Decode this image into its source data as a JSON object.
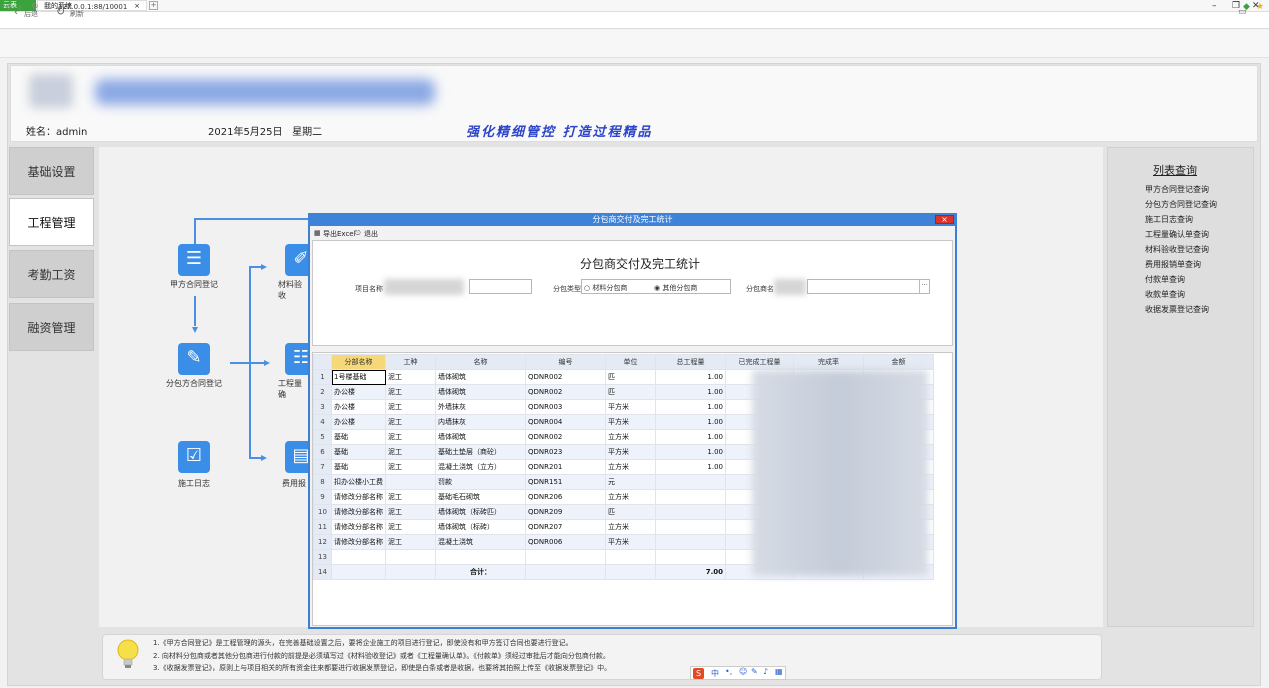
{
  "browser": {
    "tab1_label": "云表",
    "tab2_label": "我的系统",
    "tab_close": "×",
    "new_tab": "+",
    "url": "127.0.0.1:88/10001",
    "back_label": "后退",
    "refresh_label": "刷新"
  },
  "header": {
    "user": "姓名：admin",
    "date": "2021年5月25日",
    "weekday": "星期二",
    "slogan": "强化精细管控  打造过程精品"
  },
  "sidebar": {
    "items": [
      {
        "label": "基础设置"
      },
      {
        "label": "工程管理"
      },
      {
        "label": "考勤工资"
      },
      {
        "label": "融资管理"
      }
    ]
  },
  "flow": {
    "items": [
      {
        "label": "甲方合同登记"
      },
      {
        "label": "分包方合同登记"
      },
      {
        "label": "施工日志"
      },
      {
        "label": "材料验收"
      },
      {
        "label": "工程量确"
      },
      {
        "label": "费用报"
      }
    ]
  },
  "right_panel": {
    "title": "列表查询",
    "links": [
      "甲方合同登记查询",
      "分包方合同登记查询",
      "施工日志查询",
      "工程量确认单查询",
      "材料验收登记查询",
      "费用报销单查询",
      "付款单查询",
      "收款单查询",
      "收据发票登记查询"
    ]
  },
  "tips": [
    "1.《甲方合同登记》是工程管理的源头，在完善基础设置之后，要将企业施工的项目进行登记，即使没有和甲方签订合同也要进行登记。",
    "2. 向材料分包商或者其他分包商进行付款的前提是必须填写过《材料验收登记》或者《工程量确认单》。《付款单》须经过审批后才能向分包商付款。",
    "3.《收据发票登记》，原则上与项目相关的所有资金往来都要进行收据发票登记，即使是白条或者是收据，也要将其拍照上传至《收据发票登记》中。"
  ],
  "modal": {
    "title": "分包商交付及完工统计",
    "close": "×",
    "export_label": "导出Excel",
    "exit_label": "退出",
    "form_title": "分包商交付及完工统计",
    "project_label": "项目名称",
    "type_label": "分包类型",
    "radio_material": "材料分包商",
    "radio_other": "其他分包商",
    "sub_label": "分包商名",
    "ellipsis": "···"
  },
  "table": {
    "headers": [
      "分部名称",
      "工种",
      "名称",
      "编号",
      "单位",
      "总工程量",
      "已完成工程量",
      "完成率",
      "金额"
    ],
    "rows": [
      {
        "n": "1",
        "part": "1号楼基础",
        "work": "泥工",
        "name": "墙体砌筑",
        "code": "QDNR002",
        "unit": "匹",
        "qty": "1.00"
      },
      {
        "n": "2",
        "part": "办公楼",
        "work": "泥工",
        "name": "墙体砌筑",
        "code": "QDNR002",
        "unit": "匹",
        "qty": "1.00"
      },
      {
        "n": "3",
        "part": "办公楼",
        "work": "泥工",
        "name": "外墙抹灰",
        "code": "QDNR003",
        "unit": "平方米",
        "qty": "1.00"
      },
      {
        "n": "4",
        "part": "办公楼",
        "work": "泥工",
        "name": "内墙抹灰",
        "code": "QDNR004",
        "unit": "平方米",
        "qty": "1.00"
      },
      {
        "n": "5",
        "part": "基础",
        "work": "泥工",
        "name": "墙体砌筑",
        "code": "QDNR002",
        "unit": "立方米",
        "qty": "1.00"
      },
      {
        "n": "6",
        "part": "基础",
        "work": "泥工",
        "name": "基础土垫层（商砼）",
        "code": "QDNR023",
        "unit": "平方米",
        "qty": "1.00"
      },
      {
        "n": "7",
        "part": "基础",
        "work": "泥工",
        "name": "混凝土浇筑（立方）",
        "code": "QDNR201",
        "unit": "立方米",
        "qty": "1.00"
      },
      {
        "n": "8",
        "part": "扣办公楼小工费",
        "work": "",
        "name": "罚款",
        "code": "QDNR151",
        "unit": "元",
        "qty": ""
      },
      {
        "n": "9",
        "part": "请修改分部名称",
        "work": "泥工",
        "name": "基础毛石砌筑",
        "code": "QDNR206",
        "unit": "立方米",
        "qty": ""
      },
      {
        "n": "10",
        "part": "请修改分部名称",
        "work": "泥工",
        "name": "墙体砌筑（标砖匹）",
        "code": "QDNR209",
        "unit": "匹",
        "qty": ""
      },
      {
        "n": "11",
        "part": "请修改分部名称",
        "work": "泥工",
        "name": "墙体砌筑（标砖）",
        "code": "QDNR207",
        "unit": "立方米",
        "qty": ""
      },
      {
        "n": "12",
        "part": "请修改分部名称",
        "work": "泥工",
        "name": "混凝土浇筑",
        "code": "QDNR006",
        "unit": "平方米",
        "qty": ""
      },
      {
        "n": "13",
        "part": "",
        "work": "",
        "name": "",
        "code": "",
        "unit": "",
        "qty": ""
      },
      {
        "n": "14",
        "part": "",
        "work": "",
        "name": "合计：",
        "code": "",
        "unit": "",
        "qty": "7.00"
      }
    ]
  },
  "ime": {
    "label": "中"
  }
}
